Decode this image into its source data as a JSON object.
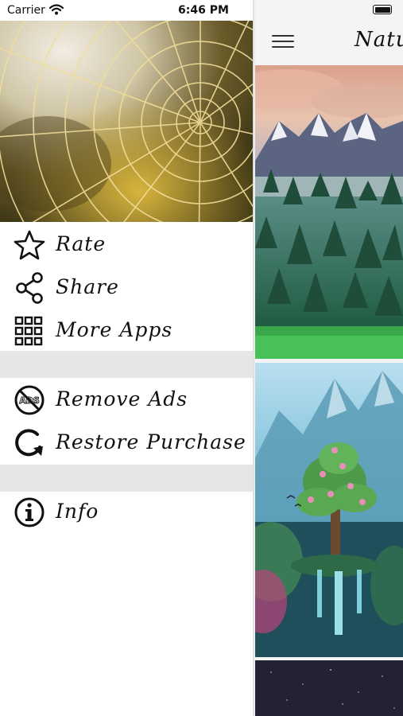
{
  "status_bar": {
    "carrier": "Carrier",
    "time": "6:46 PM"
  },
  "navbar": {
    "title": "Natu"
  },
  "drawer": {
    "menu": [
      {
        "label": "Rate",
        "icon": "star-icon"
      },
      {
        "label": "Share",
        "icon": "share-icon"
      },
      {
        "label": "More Apps",
        "icon": "grid-icon"
      },
      {
        "label": "Remove Ads",
        "icon": "no-ads-icon"
      },
      {
        "label": "Restore Purchase",
        "icon": "restore-icon"
      },
      {
        "label": "Info",
        "icon": "info-icon"
      }
    ]
  },
  "colors": {
    "separator": "#e6e6e6",
    "text": "#111111",
    "background": "#ffffff"
  }
}
